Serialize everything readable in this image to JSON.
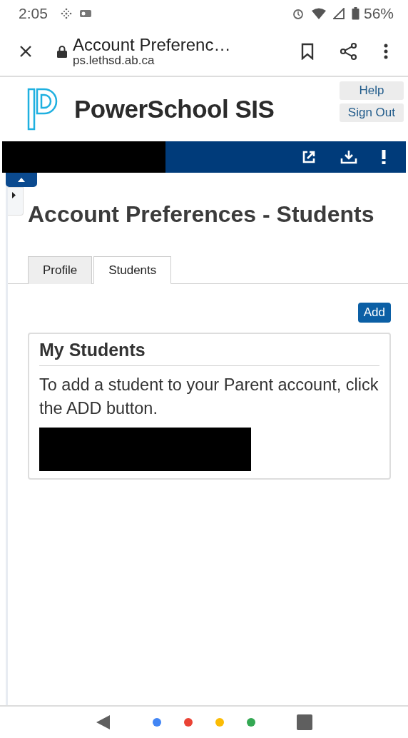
{
  "status_bar": {
    "time": "2:05",
    "battery": "56%"
  },
  "browser": {
    "title": "Account Preferenc…",
    "url": "ps.lethsd.ab.ca"
  },
  "header": {
    "brand": "PowerSchool SIS",
    "links": [
      "Help",
      "Sign Out"
    ]
  },
  "page_title": "Account Preferences - Students",
  "tabs": [
    {
      "label": "Profile",
      "selected": false
    },
    {
      "label": "Students",
      "selected": true
    }
  ],
  "add_button": "Add",
  "card": {
    "title": "My Students",
    "text": "To add a student to your Parent account, click the ADD button."
  },
  "nav_dots": [
    {
      "color": "#4285f4"
    },
    {
      "color": "#ea4335"
    },
    {
      "color": "#fbbc05"
    },
    {
      "color": "#34a853"
    }
  ]
}
